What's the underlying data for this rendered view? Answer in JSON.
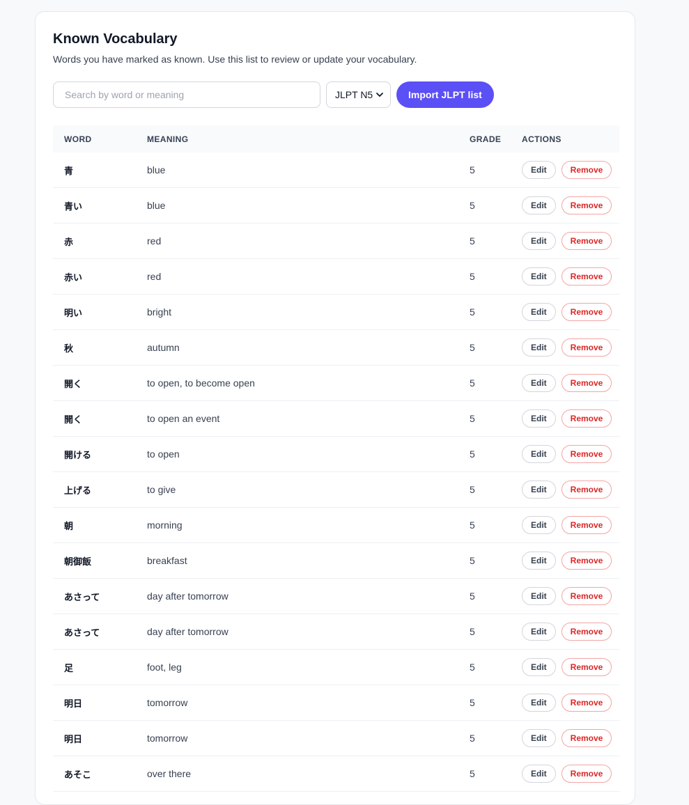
{
  "header": {
    "title": "Known Vocabulary",
    "subtitle": "Words you have marked as known. Use this list to review or update your vocabulary."
  },
  "controls": {
    "search_placeholder": "Search by word or meaning",
    "search_value": "",
    "level_selected": "JLPT N5",
    "import_label": "Import JLPT list"
  },
  "table": {
    "columns": {
      "word": "WORD",
      "meaning": "MEANING",
      "grade": "GRADE",
      "actions": "ACTIONS"
    },
    "edit_label": "Edit",
    "remove_label": "Remove",
    "rows": [
      {
        "word": "青",
        "meaning": "blue",
        "grade": "5"
      },
      {
        "word": "青い",
        "meaning": "blue",
        "grade": "5"
      },
      {
        "word": "赤",
        "meaning": "red",
        "grade": "5"
      },
      {
        "word": "赤い",
        "meaning": "red",
        "grade": "5"
      },
      {
        "word": "明い",
        "meaning": "bright",
        "grade": "5"
      },
      {
        "word": "秋",
        "meaning": "autumn",
        "grade": "5"
      },
      {
        "word": "開く",
        "meaning": "to open, to become open",
        "grade": "5"
      },
      {
        "word": "開く",
        "meaning": "to open an event",
        "grade": "5"
      },
      {
        "word": "開ける",
        "meaning": "to open",
        "grade": "5"
      },
      {
        "word": "上げる",
        "meaning": "to give",
        "grade": "5"
      },
      {
        "word": "朝",
        "meaning": "morning",
        "grade": "5"
      },
      {
        "word": "朝御飯",
        "meaning": "breakfast",
        "grade": "5"
      },
      {
        "word": "あさって",
        "meaning": "day after tomorrow",
        "grade": "5"
      },
      {
        "word": "あさって",
        "meaning": "day after tomorrow",
        "grade": "5"
      },
      {
        "word": "足",
        "meaning": "foot, leg",
        "grade": "5"
      },
      {
        "word": "明日",
        "meaning": "tomorrow",
        "grade": "5"
      },
      {
        "word": "明日",
        "meaning": "tomorrow",
        "grade": "5"
      },
      {
        "word": "あそこ",
        "meaning": "over there",
        "grade": "5"
      }
    ]
  },
  "colors": {
    "accent": "#5b4ff6",
    "danger": "#dc2626",
    "background": "#f8f9fb"
  }
}
